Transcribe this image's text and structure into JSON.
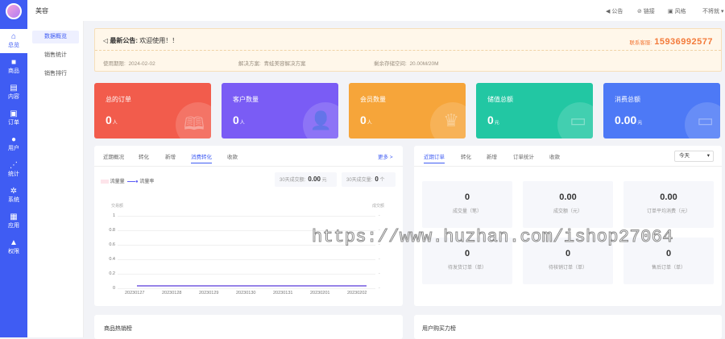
{
  "brand": "美容",
  "rail": [
    {
      "icon": "⌂",
      "label": "总览",
      "active": true
    },
    {
      "icon": "■",
      "label": "商品"
    },
    {
      "icon": "▤",
      "label": "内容"
    },
    {
      "icon": "▣",
      "label": "订单"
    },
    {
      "icon": "●",
      "label": "用户"
    },
    {
      "icon": "⋰",
      "label": "统计"
    },
    {
      "icon": "✲",
      "label": "系统"
    },
    {
      "icon": "▦",
      "label": "应用"
    },
    {
      "icon": "▲",
      "label": "权限"
    }
  ],
  "submenu": [
    "数据概览",
    "销售统计",
    "销售排行"
  ],
  "top_actions": {
    "announce": "公告",
    "link": "链接",
    "style": "风格",
    "user": "不将就"
  },
  "notice": {
    "title": "最新公告:",
    "message": "欢迎使用！！",
    "cs_label": "联系客服:",
    "cs_phone": "15936992577",
    "date_label": "使用期限:",
    "date_value": "2024-02-02",
    "plan_label": "解决方案:",
    "plan_value": "青蛙美容解决方案",
    "storage_label": "剩余存储空间:",
    "storage_value": "20.00M/20M"
  },
  "stats": [
    {
      "title": "总的订单",
      "value": "0",
      "unit": "人",
      "color": "#f25c4c",
      "icon": "🕮"
    },
    {
      "title": "客户数量",
      "value": "0",
      "unit": "人",
      "color": "#7a5cf5",
      "icon": "👤"
    },
    {
      "title": "会员数量",
      "value": "0",
      "unit": "人",
      "color": "#f6a53a",
      "icon": "♛"
    },
    {
      "title": "储值总额",
      "value": "0",
      "unit": "元",
      "color": "#22c7a3",
      "icon": "▭"
    },
    {
      "title": "消费总额",
      "value": "0.00",
      "unit": "元",
      "color": "#4d79f6",
      "icon": "▭"
    }
  ],
  "left_card": {
    "tabs": [
      "近期概况",
      "转化",
      "新增",
      "消费转化",
      "收款"
    ],
    "more": "更多 >",
    "legend": [
      "流量量",
      "流量率"
    ],
    "box1_label": "30天成交额:",
    "box1_value": "0.00",
    "box1_unit": "元",
    "box2_label": "30天成交量:",
    "box2_value": "0",
    "box2_unit": "个",
    "yleft_title": "交易额",
    "yright_title": "成交额",
    "yticks": [
      "1",
      "0.8",
      "0.6",
      "0.4",
      "0.2",
      "0"
    ],
    "xticks": [
      "20230127",
      "20230128",
      "20230129",
      "20230130",
      "20230131",
      "20230201",
      "20230202"
    ]
  },
  "right_card": {
    "tabs": [
      "近期订单",
      "转化",
      "新增",
      "订单统计",
      "收款"
    ],
    "select": "今天",
    "cells": [
      {
        "value": "0",
        "label": "成交量（笔）"
      },
      {
        "value": "0.00",
        "label": "成交额（元）"
      },
      {
        "value": "0.00",
        "label": "订单平均消费（元）"
      },
      {
        "value": "0",
        "label": "待发货订单（单）"
      },
      {
        "value": "0",
        "label": "待核销订单（单）"
      },
      {
        "value": "0",
        "label": "售后订单（单）"
      }
    ]
  },
  "bottom": {
    "left_title": "商品热销榜",
    "right_title": "用户购买力榜"
  },
  "watermark": "https://www.huzhan.com/ishop27064",
  "chart_data": {
    "type": "line",
    "categories": [
      "20230127",
      "20230128",
      "20230129",
      "20230130",
      "20230131",
      "20230201",
      "20230202"
    ],
    "series": [
      {
        "name": "流量量",
        "values": [
          0,
          0,
          0,
          0,
          0,
          0,
          0
        ]
      },
      {
        "name": "流量率",
        "values": [
          0,
          0,
          0,
          0,
          0,
          0,
          0
        ]
      }
    ],
    "ylim": [
      0,
      1
    ],
    "legend": "top-left",
    "grid": true
  }
}
